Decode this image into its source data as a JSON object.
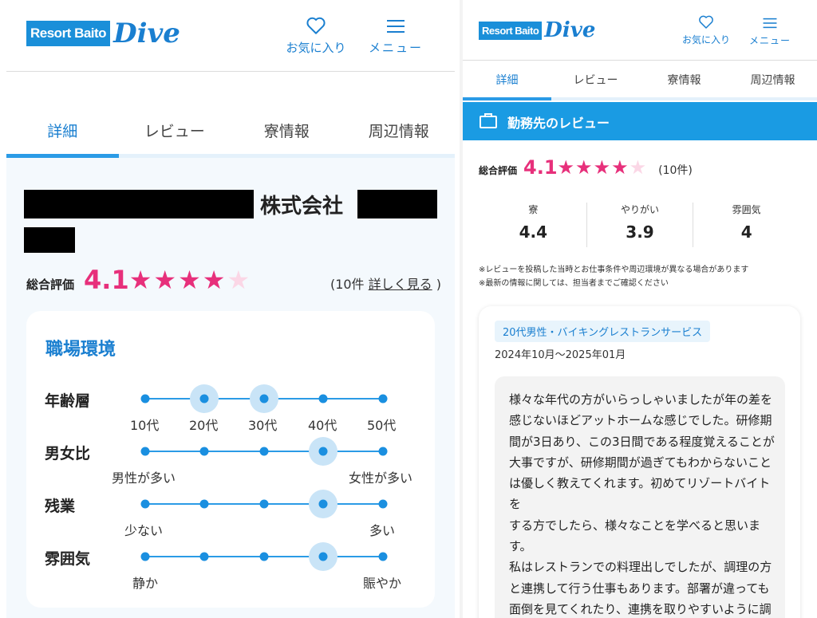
{
  "brand": {
    "logo_box": "Resort Baito",
    "logo_word": "Dive"
  },
  "header": {
    "favorite_label": "お気に入り",
    "menu_label": "メニュー"
  },
  "tabs": [
    {
      "label": "詳細",
      "active": true
    },
    {
      "label": "レビュー",
      "active": false
    },
    {
      "label": "寮情報",
      "active": false
    },
    {
      "label": "周辺情報",
      "active": false
    }
  ],
  "left": {
    "company_suffix": "株式会社",
    "rating": {
      "label": "総合評価",
      "value": "4.1",
      "count_open": "(10件 ",
      "detail_link": "詳しく見る",
      "count_close": " )"
    },
    "card": {
      "title": "職場環境",
      "rows": [
        {
          "label": "年齢層",
          "ticks": [
            "10代",
            "20代",
            "30代",
            "40代",
            "50代"
          ],
          "highlighted_positions": [
            1,
            2
          ]
        },
        {
          "label": "男女比",
          "min_label": "男性が多い",
          "max_label": "女性が多い",
          "highlighted_positions": [
            3
          ]
        },
        {
          "label": "残業",
          "min_label": "少ない",
          "max_label": "多い",
          "highlighted_positions": [
            3
          ]
        },
        {
          "label": "雰囲気",
          "min_label": "静か",
          "max_label": "賑やか",
          "highlighted_positions": [
            3
          ]
        }
      ]
    }
  },
  "right": {
    "section_title": "勤務先のレビュー",
    "rating": {
      "label": "総合評価",
      "value": "4.1",
      "count": "(10件)"
    },
    "sub_scores": [
      {
        "label": "寮",
        "value": "4.4"
      },
      {
        "label": "やりがい",
        "value": "3.9"
      },
      {
        "label": "雰囲気",
        "value": "4"
      }
    ],
    "notes": [
      "※レビューを投稿した当時とお仕事条件や周辺環境が異なる場合があります",
      "※最新の情報に関しては、担当者までご確認ください"
    ],
    "review": {
      "tag": "20代男性・バイキングレストランサービス",
      "period": "2024年10月〜2025年01月",
      "text": "様々な年代の方がいらっしゃいましたが年の差を\n感じないほどアットホームな感じでした。研修期\n間が3日あり、この3日間である程度覚えることが\n大事ですが、研修期間が過ぎてもわからないこと\nは優しく教えてくれます。初めてリゾートバイトを\nする方でしたら、様々なことを学べると思います。\n私はレストランでの料理出しでしたが、調理の方\nと連携して行う仕事もあります。部署が違っても\n面倒を見てくれたり、連携を取りやすいように調\n理方から改善案を出してくれたりと働きやすい印\n象でした。清掃の方もフロント方も洗い場の方も\n皆さんいい人でした。勝として朝と夜バイキング"
    }
  },
  "rating_value": 4.1,
  "colors": {
    "accent": "#1a9be3",
    "star": "#e7307b",
    "star_empty": "#fbd7e6",
    "brand_blue": "#1a7fd0"
  }
}
